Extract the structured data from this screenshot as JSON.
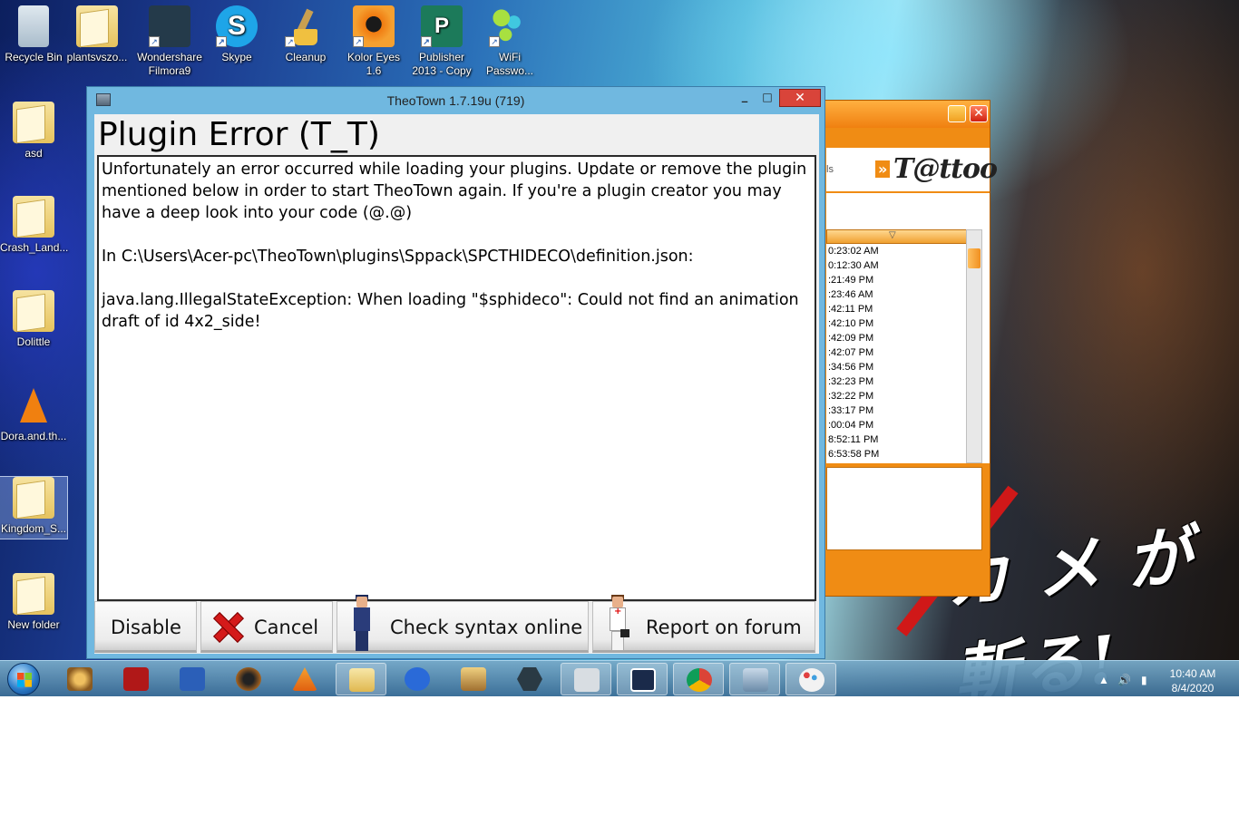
{
  "desktop": {
    "icons": [
      {
        "label": "Recycle Bin",
        "icon": "recycle-bin-icon"
      },
      {
        "label": "plantsvszo...",
        "icon": "folder-icon"
      },
      {
        "label": "Wondershare Filmora9",
        "icon": "filmora-icon"
      },
      {
        "label": "Skype",
        "icon": "skype-icon"
      },
      {
        "label": "Cleanup",
        "icon": "cleanup-icon"
      },
      {
        "label": "Kolor Eyes 1.6",
        "icon": "kolor-eyes-icon"
      },
      {
        "label": "Publisher 2013 - Copy",
        "icon": "publisher-icon"
      },
      {
        "label": "WiFi Passwo...",
        "icon": "wifi-password-icon"
      },
      {
        "label": "asd",
        "icon": "folder-icon"
      },
      {
        "label": "Crash_Land...",
        "icon": "folder-icon"
      },
      {
        "label": "Dolittle",
        "icon": "folder-icon"
      },
      {
        "label": "Dora.and.th...",
        "icon": "vlc-icon"
      },
      {
        "label": "Kingdom_S...",
        "icon": "folder-icon"
      },
      {
        "label": "New folder",
        "icon": "folder-icon"
      }
    ]
  },
  "theotown": {
    "window_title": "TheoTown 1.7.19u (719)",
    "minimize": "_",
    "maximize": "□",
    "close": "✕",
    "heading": "Plugin Error (T_T)",
    "message1": "Unfortunately an error occurred while loading your plugins. Update or remove the plugin mentioned below in order to start TheoTown again. If you're a plugin creator you may have a deep look into your code (@.@)",
    "message2": "In C:\\Users\\Acer-pc\\TheoTown\\plugins\\Sppack\\SPCTHIDECO\\definition.json:",
    "message3": "java.lang.IllegalStateException: When loading \"$sphideco\": Could not find an animation draft of id 4x2_side!",
    "buttons": {
      "disable": "Disable",
      "cancel": "Cancel",
      "check_syntax": "Check syntax online",
      "report": "Report on forum"
    }
  },
  "tattoo": {
    "logo": "T@ttoo",
    "arrows": "»",
    "side_text": "ls",
    "times": [
      "0:23:02 AM",
      "0:12:30 AM",
      ":21:49 PM",
      ":23:46 AM",
      ":42:11 PM",
      ":42:10 PM",
      ":42:09 PM",
      ":42:07 PM",
      ":34:56 PM",
      ":32:23 PM",
      ":32:22 PM",
      ":33:17 PM",
      ":00:04 PM",
      "8:52:11 PM",
      "6:53:58 PM"
    ]
  },
  "wallpaper_text": "カ メ が 斬る!",
  "taskbar": {
    "apps": [
      "media-player-icon",
      "power-icon",
      "word-icon",
      "speaker-app-icon",
      "vlc-icon",
      "file-explorer-icon",
      "wps-icon",
      "doc-app-icon",
      "nox-icon",
      "tattoo-icon",
      "dolby-icon",
      "chrome-icon",
      "theotown-icon",
      "paint-icon"
    ]
  },
  "tray": {
    "time": "10:40 AM",
    "date": "8/4/2020"
  },
  "colors": {
    "titlebar": "#70b8e0",
    "close_red": "#d9443a",
    "tattoo_orange": "#f08c14"
  }
}
